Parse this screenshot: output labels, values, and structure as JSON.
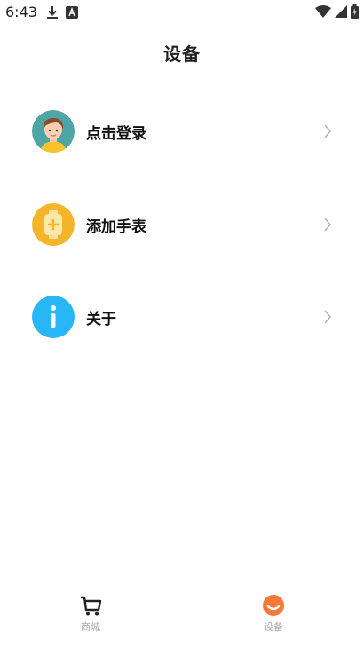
{
  "status_bar": {
    "time": "6:43",
    "icons": [
      "download-icon",
      "a-app-icon",
      "wifi-icon",
      "signal-icon",
      "battery-icon"
    ]
  },
  "header": {
    "title": "设备"
  },
  "menu": {
    "items": [
      {
        "label": "点击登录",
        "icon": "avatar-icon"
      },
      {
        "label": "添加手表",
        "icon": "add-watch-icon"
      },
      {
        "label": "关于",
        "icon": "info-icon"
      }
    ]
  },
  "bottom_nav": {
    "tabs": [
      {
        "label": "商城",
        "icon": "cart-icon",
        "active": false
      },
      {
        "label": "设备",
        "icon": "device-icon",
        "active": true
      }
    ]
  },
  "colors": {
    "watch_icon": "#f5b52a",
    "info_icon": "#29b6f6",
    "device_tab_icon": "#f47a3a",
    "nav_label": "#a9a9a9",
    "chevron": "#b5b5b5"
  }
}
